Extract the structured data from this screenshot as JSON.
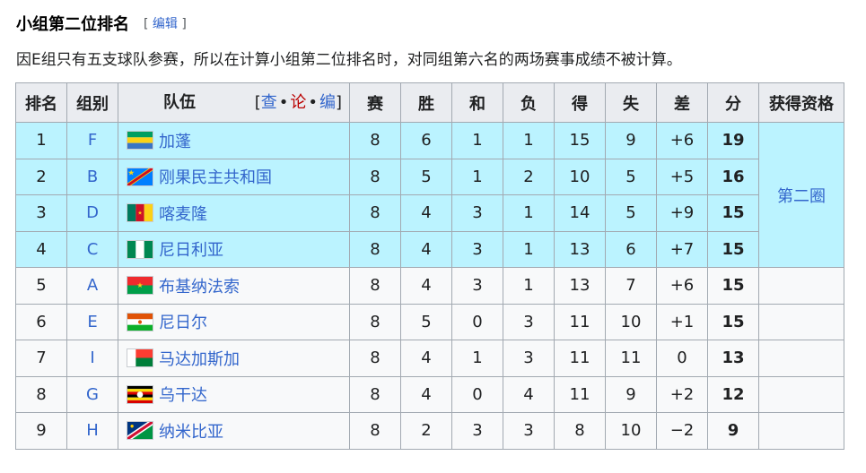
{
  "heading": {
    "title": "小组第二位排名",
    "edit_open": "[",
    "edit_label": "编辑",
    "edit_close": "]"
  },
  "note": "因E组只有五支球队参赛，所以在计算小组第二位排名时，对同组第六名的两场赛事成绩不被计算。",
  "columns": {
    "rank": "排名",
    "group": "组别",
    "team": "队伍",
    "played": "赛",
    "won": "胜",
    "drawn": "和",
    "lost": "负",
    "gf": "得",
    "ga": "失",
    "gd": "差",
    "pts": "分",
    "qual": "获得资格"
  },
  "navbox": {
    "open": "[",
    "view": "查",
    "sep1": "•",
    "talk": "论",
    "sep2": "•",
    "edit": "编",
    "close": "]"
  },
  "qualification": {
    "label": "第二圈"
  },
  "rows": [
    {
      "rank": "1",
      "group": "F",
      "team": "加蓬",
      "flag": "gabon-flag",
      "played": "8",
      "won": "6",
      "drawn": "1",
      "lost": "1",
      "gf": "15",
      "ga": "9",
      "gd": "+6",
      "pts": "19"
    },
    {
      "rank": "2",
      "group": "B",
      "team": "刚果民主共和国",
      "flag": "drc-flag",
      "played": "8",
      "won": "5",
      "drawn": "1",
      "lost": "2",
      "gf": "10",
      "ga": "5",
      "gd": "+5",
      "pts": "16"
    },
    {
      "rank": "3",
      "group": "D",
      "team": "喀麦隆",
      "flag": "cameroon-flag",
      "played": "8",
      "won": "4",
      "drawn": "3",
      "lost": "1",
      "gf": "14",
      "ga": "5",
      "gd": "+9",
      "pts": "15"
    },
    {
      "rank": "4",
      "group": "C",
      "team": "尼日利亚",
      "flag": "nigeria-flag",
      "played": "8",
      "won": "4",
      "drawn": "3",
      "lost": "1",
      "gf": "13",
      "ga": "6",
      "gd": "+7",
      "pts": "15"
    },
    {
      "rank": "5",
      "group": "A",
      "team": "布基纳法索",
      "flag": "burkina-faso-flag",
      "played": "8",
      "won": "4",
      "drawn": "3",
      "lost": "1",
      "gf": "13",
      "ga": "7",
      "gd": "+6",
      "pts": "15"
    },
    {
      "rank": "6",
      "group": "E",
      "team": "尼日尔",
      "flag": "niger-flag",
      "played": "8",
      "won": "5",
      "drawn": "0",
      "lost": "3",
      "gf": "11",
      "ga": "10",
      "gd": "+1",
      "pts": "15"
    },
    {
      "rank": "7",
      "group": "I",
      "team": "马达加斯加",
      "flag": "madagascar-flag",
      "played": "8",
      "won": "4",
      "drawn": "1",
      "lost": "3",
      "gf": "11",
      "ga": "11",
      "gd": "0",
      "pts": "13"
    },
    {
      "rank": "8",
      "group": "G",
      "team": "乌干达",
      "flag": "uganda-flag",
      "played": "8",
      "won": "4",
      "drawn": "0",
      "lost": "4",
      "gf": "11",
      "ga": "9",
      "gd": "+2",
      "pts": "12"
    },
    {
      "rank": "9",
      "group": "H",
      "team": "纳米比亚",
      "flag": "namibia-flag",
      "played": "8",
      "won": "2",
      "drawn": "3",
      "lost": "3",
      "gf": "8",
      "ga": "10",
      "gd": "−2",
      "pts": "9"
    }
  ],
  "colors": {
    "advance": "#bbf3ff",
    "out": "#f8f9fa",
    "header": "#eaecf0",
    "link": "#3366cc",
    "talk": "#ba0000"
  }
}
